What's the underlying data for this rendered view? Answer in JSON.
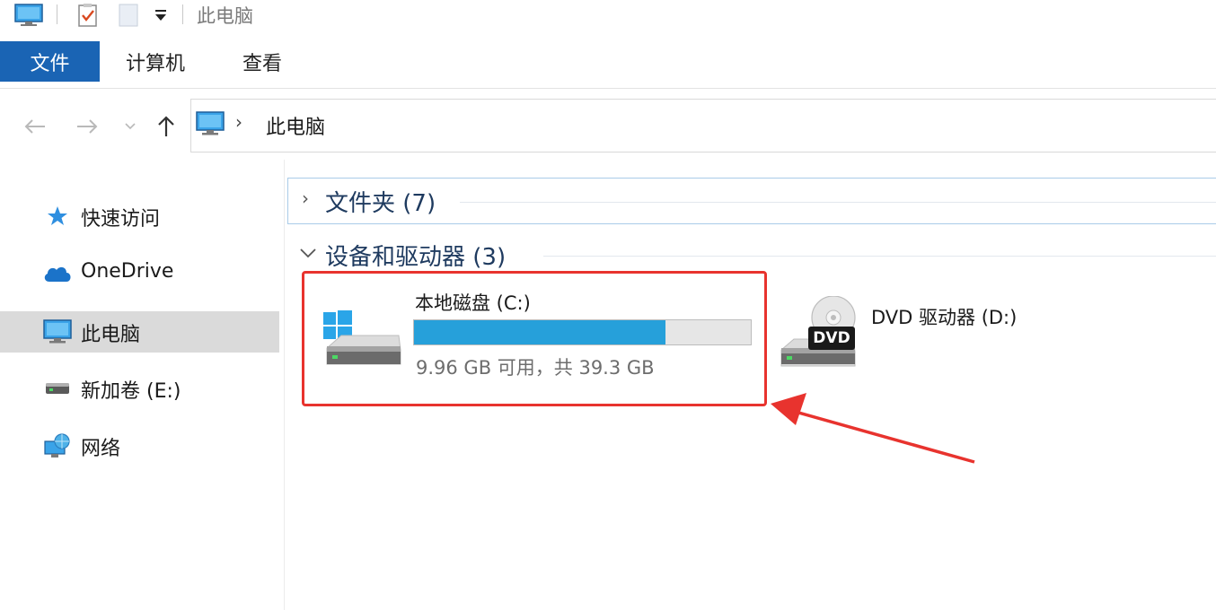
{
  "window": {
    "title": "此电脑"
  },
  "ribbon": {
    "tabs": [
      {
        "label": "文件",
        "active": true
      },
      {
        "label": "计算机",
        "active": false
      },
      {
        "label": "查看",
        "active": false
      }
    ]
  },
  "address_bar": {
    "path": "此电脑"
  },
  "sidebar": {
    "items": [
      {
        "label": "快速访问",
        "icon": "star-icon"
      },
      {
        "label": "OneDrive",
        "icon": "cloud-icon"
      },
      {
        "label": "此电脑",
        "icon": "computer-icon",
        "selected": true
      },
      {
        "label": "新加卷 (E:)",
        "icon": "drive-icon"
      },
      {
        "label": "网络",
        "icon": "network-icon"
      }
    ]
  },
  "content": {
    "groups": [
      {
        "label": "文件夹 (7)",
        "expanded": false
      },
      {
        "label": "设备和驱动器 (3)",
        "expanded": true
      }
    ],
    "drives": [
      {
        "name": "本地磁盘 (C:)",
        "free_text": "9.96 GB 可用，共 39.3 GB",
        "used_fraction": 0.747,
        "icon": "windows-drive-icon"
      },
      {
        "name": "DVD 驱动器 (D:)",
        "badge": "DVD",
        "icon": "dvd-drive-icon"
      }
    ]
  },
  "colors": {
    "accent": "#1a64b4",
    "bar_fill": "#26a0da",
    "highlight": "#e8332e",
    "selected_bg": "#dadada"
  }
}
